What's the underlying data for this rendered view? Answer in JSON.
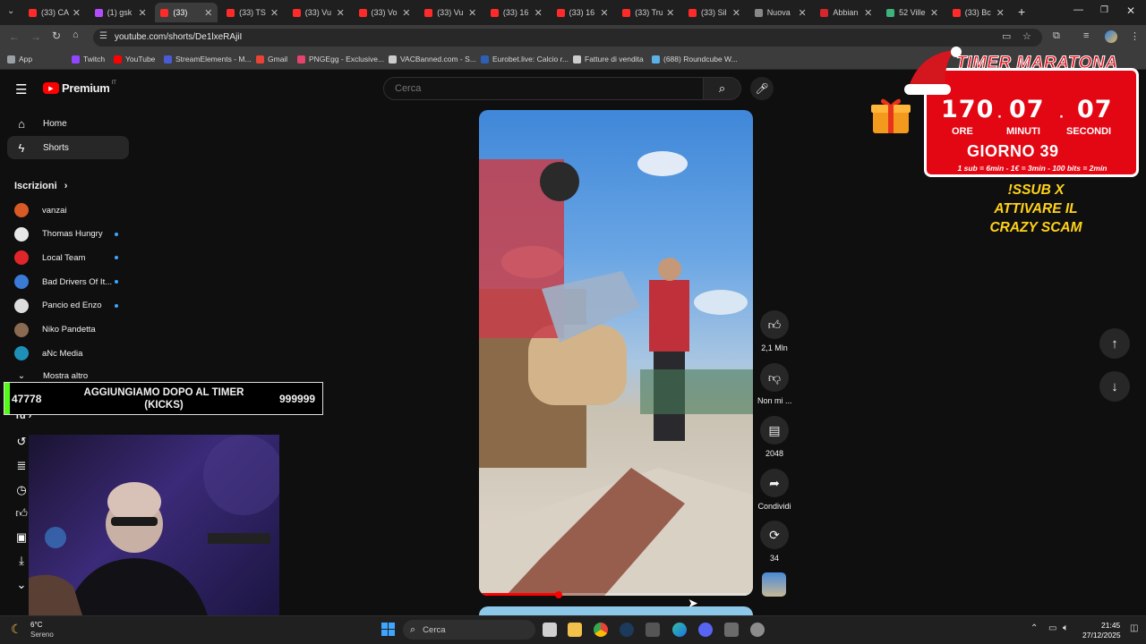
{
  "browser": {
    "tabs": [
      {
        "label": "(33) CA",
        "color": "#ff2a2a"
      },
      {
        "label": "(1) gsk",
        "color": "#b14cff"
      },
      {
        "label": "(33)",
        "color": "#ff2a2a",
        "active": true
      },
      {
        "label": "(33) TS",
        "color": "#ff2a2a"
      },
      {
        "label": "(33) Vu",
        "color": "#ff2a2a"
      },
      {
        "label": "(33) Vo",
        "color": "#ff2a2a"
      },
      {
        "label": "(33) Vu",
        "color": "#ff2a2a"
      },
      {
        "label": "(33) 16",
        "color": "#ff2a2a"
      },
      {
        "label": "(33) 16",
        "color": "#ff2a2a"
      },
      {
        "label": "(33) Tru",
        "color": "#ff2a2a"
      },
      {
        "label": "(33) Sil",
        "color": "#ff2a2a"
      },
      {
        "label": "Nuova",
        "color": "#888888"
      },
      {
        "label": "Abbian",
        "color": "#d4262d"
      },
      {
        "label": "52 Ville",
        "color": "#3bb37b"
      },
      {
        "label": "(33) Bc",
        "color": "#ff2a2a"
      }
    ],
    "url": "youtube.com/shorts/De1lxeRAjiI",
    "bookmarks": [
      {
        "label": "App",
        "color": "#9aa0a6"
      },
      {
        "label": "Twitch",
        "color": "#9146ff"
      },
      {
        "label": "YouTube",
        "color": "#ff0000"
      },
      {
        "label": "StreamElements - M...",
        "color": "#4a5bd8"
      },
      {
        "label": "Gmail",
        "color": "#ea4335"
      },
      {
        "label": "PNGEgg - Exclusive...",
        "color": "#e6436d"
      },
      {
        "label": "VACBanned.com - S...",
        "color": "#cccccc"
      },
      {
        "label": "Eurobet.live: Calcio r...",
        "color": "#2d5fb5"
      },
      {
        "label": "Fatture di vendita",
        "color": "#cccccc"
      },
      {
        "label": "(688) Roundcube W...",
        "color": "#5bb0e8"
      }
    ]
  },
  "youtube": {
    "logo_text": "Premium",
    "logo_region": "IT",
    "search_placeholder": "Cerca",
    "nav": [
      {
        "label": "Home",
        "icon": "home-icon"
      },
      {
        "label": "Shorts",
        "icon": "shorts-icon"
      }
    ],
    "subs_header": "Iscrizioni",
    "subscriptions": [
      {
        "name": "vanzai",
        "color": "#d85a24",
        "dot": false
      },
      {
        "name": "Thomas Hungry",
        "color": "#e8e8e8",
        "dot": true
      },
      {
        "name": "Local Team",
        "color": "#e0262b",
        "dot": true
      },
      {
        "name": "Bad Drivers Of It...",
        "color": "#3a7bd5",
        "dot": true
      },
      {
        "name": "Pancio ed Enzo",
        "color": "#dddddd",
        "dot": true
      },
      {
        "name": "Niko Pandetta",
        "color": "#8a6a50",
        "dot": false
      },
      {
        "name": "aNc Media",
        "color": "#1e90b8",
        "dot": false
      }
    ],
    "show_more": "Mostra altro",
    "you_label": "Tu",
    "actions": {
      "likes": "2,1 Mln",
      "dislike": "Non mi ...",
      "comments": "2048",
      "share": "Condividi",
      "remix": "34"
    },
    "progress": 0.29
  },
  "overlays": {
    "kicks_bar": {
      "left": "47778",
      "center": "AGGIUNGIAMO DOPO AL TIMER (KICKS)",
      "right": "999999"
    },
    "timer": {
      "title": "TIMER MARATONA",
      "hours": "170",
      "minutes": "07",
      "seconds": "07",
      "hours_label": "ORE",
      "minutes_label": "MINUTI",
      "seconds_label": "SECONDI",
      "day": "GIORNO 39",
      "rates": "1 sub = 6min - 1€ = 3min - 100 bits = 2min"
    },
    "sub_text": [
      "!SSUB X",
      "ATTIVARE IL",
      "CRAZY SCAM"
    ]
  },
  "taskbar": {
    "weather_temp": "6°C",
    "weather_desc": "Sereno",
    "search": "Cerca",
    "time": "21:45",
    "date": "27/12/2025"
  }
}
